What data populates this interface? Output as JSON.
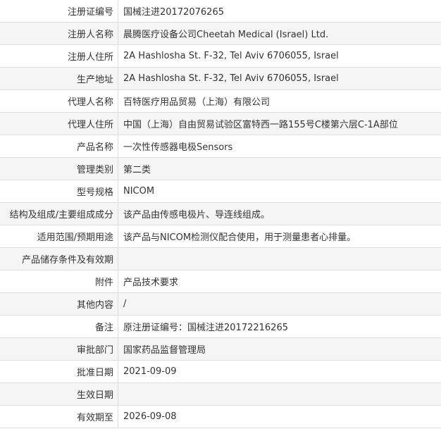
{
  "rows": [
    {
      "label": "注册证编号",
      "value": "国械注进20172076265"
    },
    {
      "label": "注册人名称",
      "value": "晨腾医疗设备公司Cheetah Medical (Israel) Ltd."
    },
    {
      "label": "注册人住所",
      "value": "2A Hashlosha St. F-32, Tel Aviv 6706055, Israel"
    },
    {
      "label": "生产地址",
      "value": "2A Hashlosha St. F-32, Tel Aviv 6706055, Israel"
    },
    {
      "label": "代理人名称",
      "value": "百特医疗用品贸易（上海）有限公司"
    },
    {
      "label": "代理人住所",
      "value": "中国（上海）自由贸易试验区富特西一路155号C楼第六层C-1A部位"
    },
    {
      "label": "产品名称",
      "value": "一次性传感器电极Sensors"
    },
    {
      "label": "管理类别",
      "value": "第二类"
    },
    {
      "label": "型号规格",
      "value": "NICOM"
    },
    {
      "label": "结构及组成/主要组成成分",
      "value": "该产品由传感电极片、导连线组成。"
    },
    {
      "label": "适用范围/预期用途",
      "value": "该产品与NICOM检测仪配合使用，用于测量患者心排量。"
    },
    {
      "label": "产品储存条件及有效期",
      "value": ""
    },
    {
      "label": "附件",
      "value": "产品技术要求"
    },
    {
      "label": "其他内容",
      "value": "/"
    },
    {
      "label": "备注",
      "value": "原注册证编号：国械注进20172216265"
    },
    {
      "label": "审批部门",
      "value": "国家药品监督管理局"
    },
    {
      "label": "批准日期",
      "value": "2021-09-09"
    },
    {
      "label": "生效日期",
      "value": ""
    },
    {
      "label": "有效期至",
      "value": "2026-09-08"
    }
  ]
}
